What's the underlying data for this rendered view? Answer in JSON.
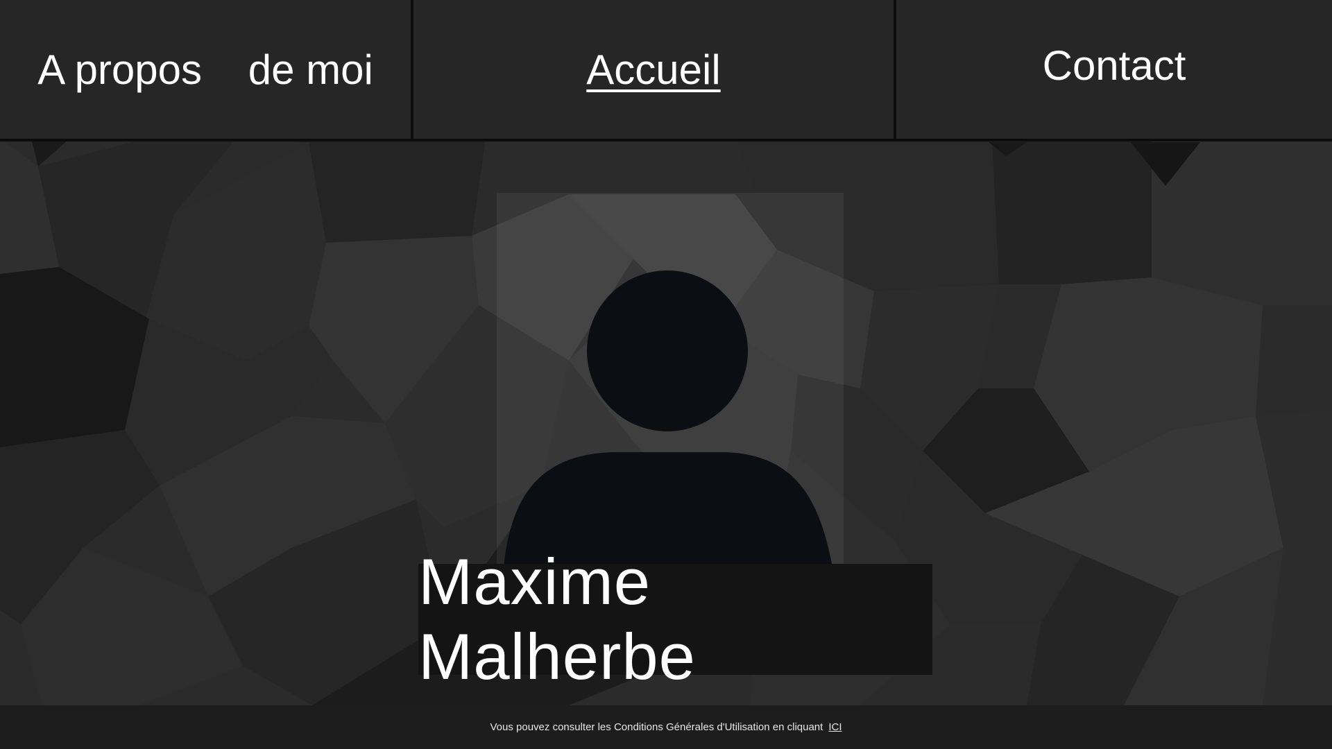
{
  "nav": {
    "about": "A propos    de moi",
    "home": "Accueil",
    "contact": "Contact"
  },
  "hero": {
    "name": "Maxime Malherbe",
    "avatar_icon": "user-silhouette-icon"
  },
  "footer": {
    "text": "Vous pouvez consulter les Conditions Générales d'Utilisation en cliquant",
    "link": "ICI"
  },
  "colors": {
    "nav_bg": "#262626",
    "name_bg": "#141414",
    "silhouette": "#0b0e12",
    "text": "#ffffff"
  }
}
